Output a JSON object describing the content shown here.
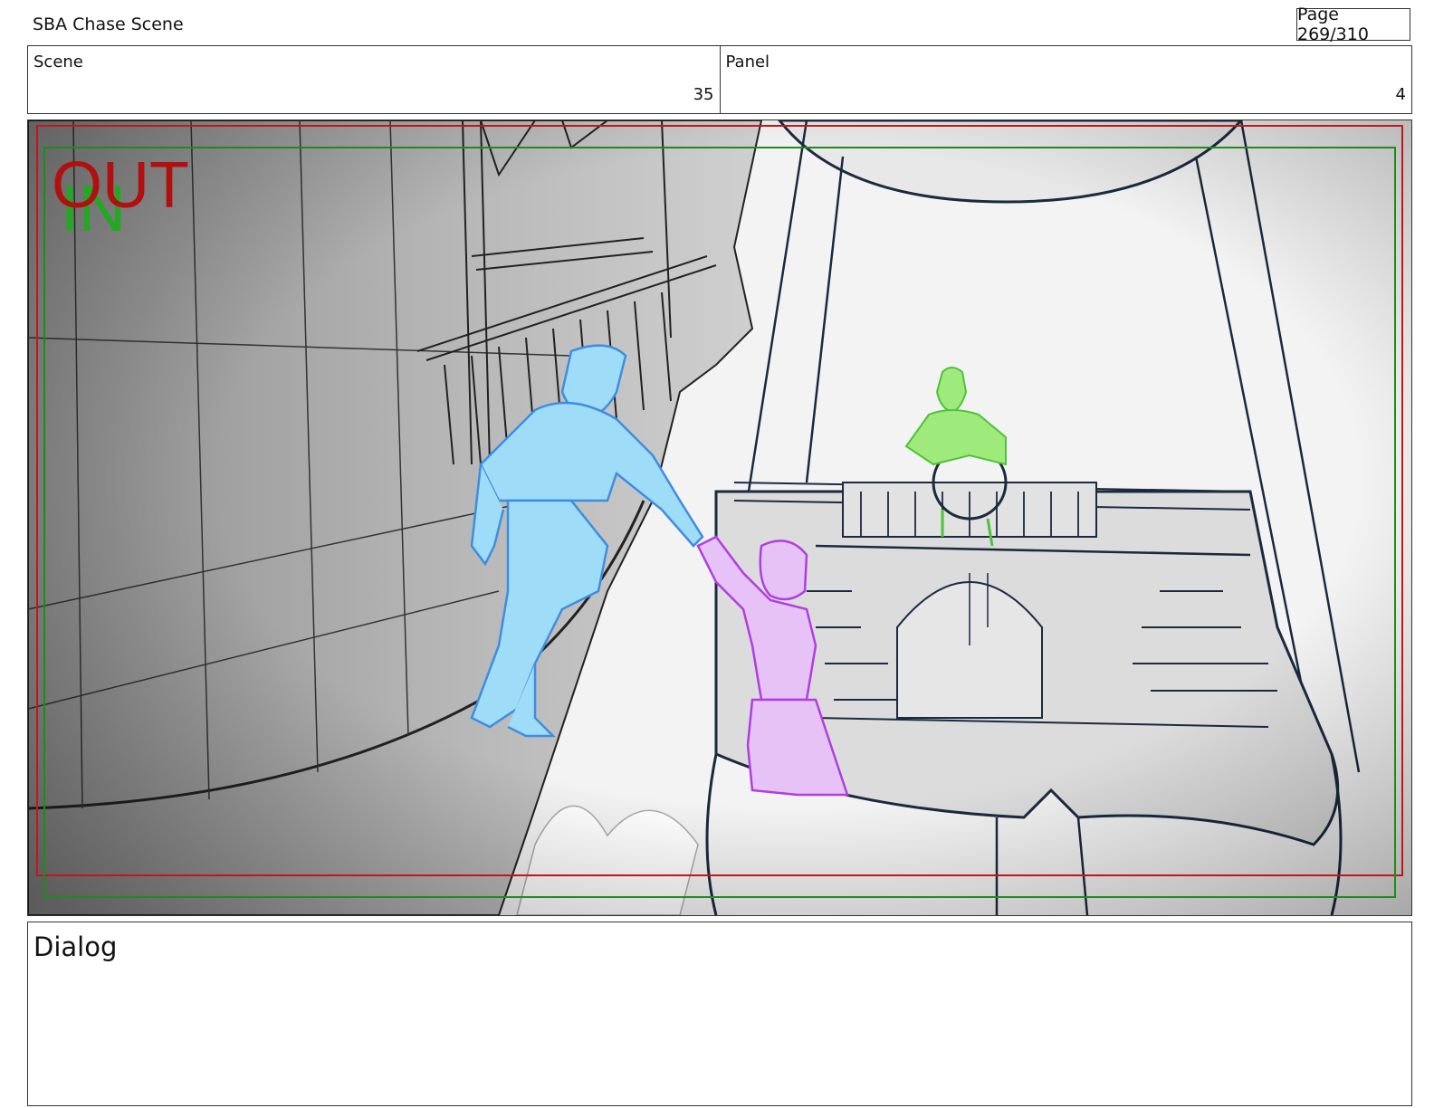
{
  "header": {
    "title": "SBA Chase Scene",
    "page": "Page 269/310"
  },
  "info": {
    "scene_label": "Scene",
    "scene_value": "35",
    "panel_label": "Panel",
    "panel_value": "4"
  },
  "panel": {
    "out_label": "OUT",
    "in_label": "IN",
    "colors": {
      "out_frame": "#c01818",
      "in_frame": "#1f8a1f",
      "hero": "#9fdcf8",
      "hero_line": "#3f8de0",
      "girl": "#e6c2f6",
      "girl_line": "#b03ee0",
      "captain": "#9eea7a",
      "captain_line": "#4fc23a"
    }
  },
  "dialog": {
    "label": "Dialog"
  }
}
